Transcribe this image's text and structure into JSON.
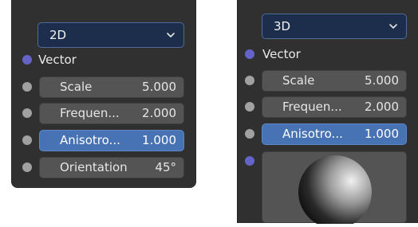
{
  "left_node": {
    "dimension_value": "2D",
    "vector_label": "Vector",
    "fields": [
      {
        "name": "Scale",
        "value": "5.000",
        "active": false
      },
      {
        "name": "Frequen...",
        "value": "2.000",
        "active": false
      },
      {
        "name": "Anisotro...",
        "value": "1.000",
        "active": true
      },
      {
        "name": "Orientation",
        "value": "45°",
        "active": false
      }
    ]
  },
  "right_node": {
    "dimension_value": "3D",
    "vector_label": "Vector",
    "fields": [
      {
        "name": "Scale",
        "value": "5.000",
        "active": false
      },
      {
        "name": "Frequen...",
        "value": "2.000",
        "active": false
      },
      {
        "name": "Anisotro...",
        "value": "1.000",
        "active": true
      }
    ]
  },
  "colors": {
    "node_bg": "#303030",
    "field_bg": "#545454",
    "active_field": "#4772b3",
    "dropdown_bg": "#1d2e4d",
    "vector_socket": "#6464c8",
    "float_socket": "#a1a1a1"
  },
  "icons": {
    "dropdown": "chevron-down-icon"
  }
}
